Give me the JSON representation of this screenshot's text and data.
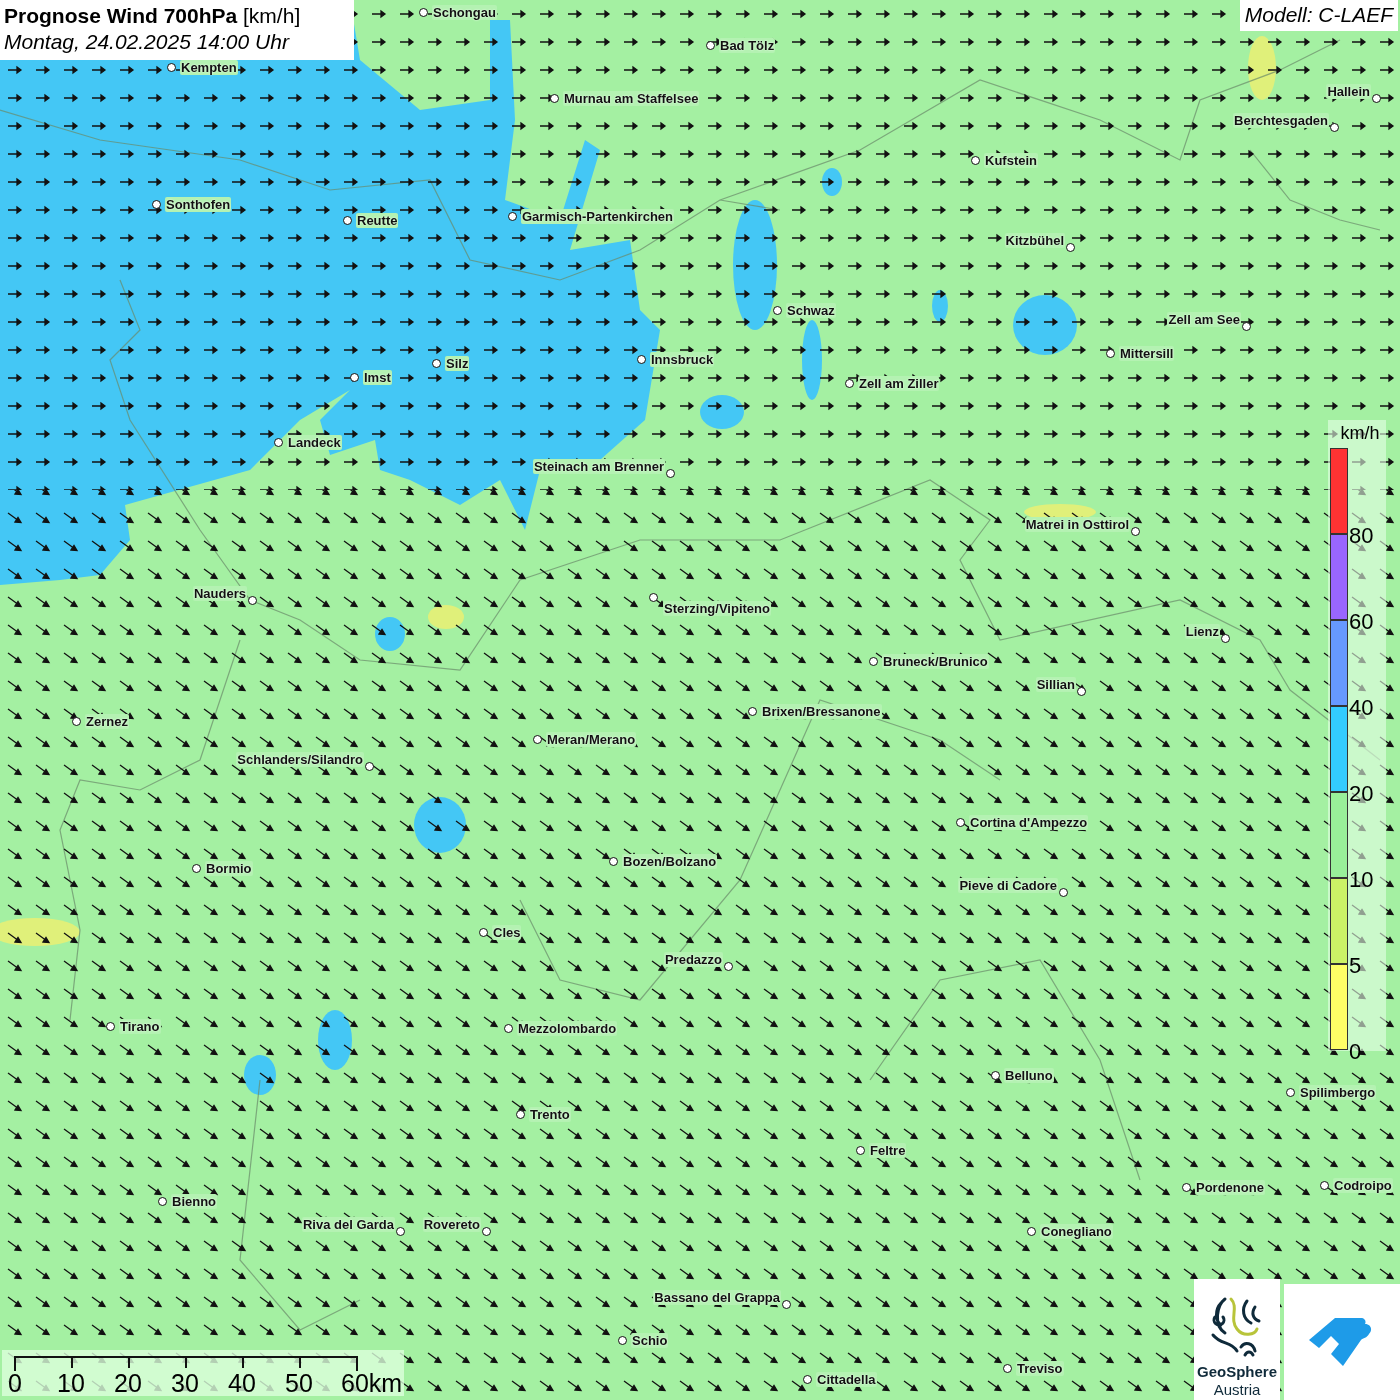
{
  "title": {
    "heading": "**Prognose Wind 700hPa** [km/h]",
    "date": "Montag, 24.02.2025 14:00 Uhr"
  },
  "model": "Modell: C-LAEF",
  "cities": [
    {
      "name": "Schongau"
    },
    {
      "name": "Bad Tölz"
    },
    {
      "name": "Kempten"
    },
    {
      "name": "Murnau am Staffelsee"
    },
    {
      "name": "Hallein"
    },
    {
      "name": "Berchtesgaden"
    },
    {
      "name": "Kufstein"
    },
    {
      "name": "Sonthofen"
    },
    {
      "name": "Reutte"
    },
    {
      "name": "Garmisch-Partenkirchen"
    },
    {
      "name": "Kitzbühel"
    },
    {
      "name": "Schwaz"
    },
    {
      "name": "Zell am See"
    },
    {
      "name": "Innsbruck"
    },
    {
      "name": "Mittersill"
    },
    {
      "name": "Silz"
    },
    {
      "name": "Imst"
    },
    {
      "name": "Zell am Ziller"
    },
    {
      "name": "Landeck"
    },
    {
      "name": "Steinach am Brenner"
    },
    {
      "name": "Matrei in Osttirol"
    },
    {
      "name": "Nauders"
    },
    {
      "name": "Sterzing/Vipiteno"
    },
    {
      "name": "Lienz"
    },
    {
      "name": "Bruneck/Brunico"
    },
    {
      "name": "Sillian"
    },
    {
      "name": "Brixen/Bressanone"
    },
    {
      "name": "Zernez"
    },
    {
      "name": "Meran/Merano"
    },
    {
      "name": "Schlanders/Silandro"
    },
    {
      "name": "Cortina d'Ampezzo"
    },
    {
      "name": "Bozen/Bolzano"
    },
    {
      "name": "Bormio"
    },
    {
      "name": "Pieve di Cadore"
    },
    {
      "name": "Cles"
    },
    {
      "name": "Predazzo"
    },
    {
      "name": "Tirano"
    },
    {
      "name": "Mezzolombardo"
    },
    {
      "name": "Belluno"
    },
    {
      "name": "Spilimbergo"
    },
    {
      "name": "Trento"
    },
    {
      "name": "Feltre"
    },
    {
      "name": "Pordenone"
    },
    {
      "name": "Codroipo"
    },
    {
      "name": "Bienno"
    },
    {
      "name": "Riva del Garda"
    },
    {
      "name": "Rovereto"
    },
    {
      "name": "Conegliano"
    },
    {
      "name": "Bassano del Grappa"
    },
    {
      "name": "Schio"
    },
    {
      "name": "Treviso"
    },
    {
      "name": "Cittadella"
    }
  ],
  "legend": {
    "unit": "km/h",
    "steps": [
      {
        "label": "80",
        "color": "#ff3333"
      },
      {
        "label": "60",
        "color": "#9966ff"
      },
      {
        "label": "40",
        "color": "#6699ff"
      },
      {
        "label": "20",
        "color": "#33ccff"
      },
      {
        "label": "10",
        "color": "#99f099"
      },
      {
        "label": "5",
        "color": "#ccf266"
      },
      {
        "label": "0",
        "color": "#ffff66"
      }
    ]
  },
  "scale_bar": {
    "ticks": [
      "0",
      "10",
      "20",
      "30",
      "40",
      "50",
      "60km"
    ]
  },
  "logo": {
    "name": "GeoSphere",
    "subtitle": "Austria"
  }
}
